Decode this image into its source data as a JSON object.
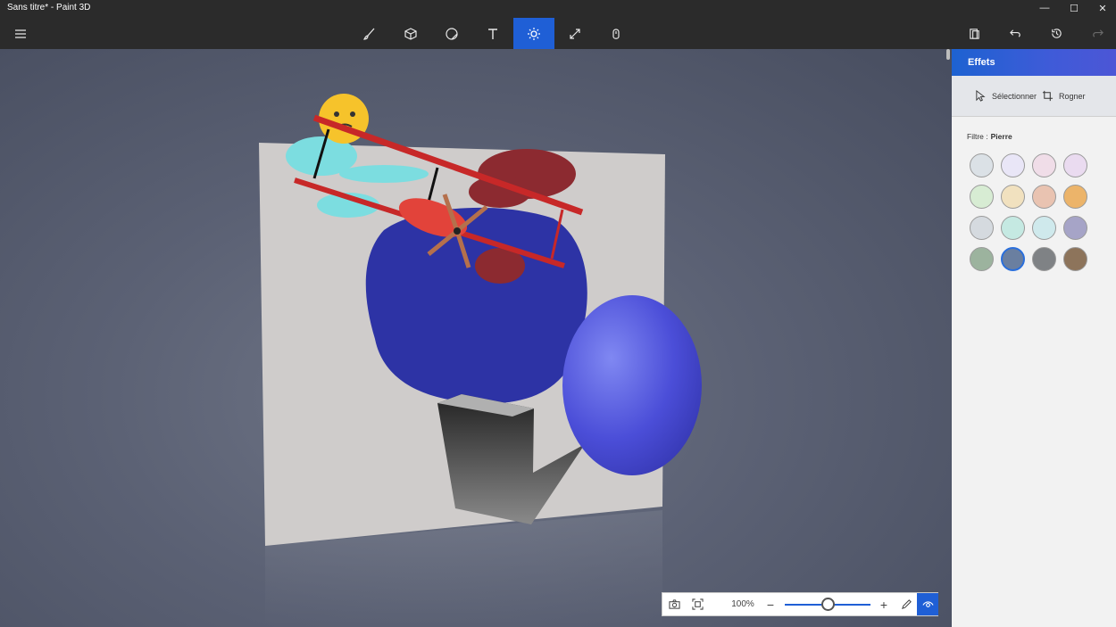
{
  "window": {
    "title": "Sans titre* - Paint 3D"
  },
  "toolbar": {
    "tools": [
      {
        "name": "brushes-icon"
      },
      {
        "name": "3d-shapes-icon"
      },
      {
        "name": "stickers-icon"
      },
      {
        "name": "text-icon"
      },
      {
        "name": "effects-icon",
        "active": true
      },
      {
        "name": "canvas-icon"
      },
      {
        "name": "remix3d-icon"
      }
    ],
    "accent_color": "#1f5fd6"
  },
  "panel": {
    "title": "Effets",
    "select_label": "Sélectionner",
    "crop_label": "Rogner",
    "filter_label": "Filtre :",
    "filter_value": "Pierre",
    "swatches": [
      "#dbe1e6",
      "#e9e6f7",
      "#f0dde8",
      "#eadbf0",
      "#d7ecd3",
      "#f1e1bf",
      "#e9c3b1",
      "#ecb46a",
      "#d5dadf",
      "#c5e9e2",
      "#cfe9ec",
      "#a6a4c7",
      "#9cb39e",
      "#6a7fa0",
      "#7f8285",
      "#8d745b"
    ],
    "selected_swatch": 13
  },
  "zoom": {
    "value": "100%",
    "level_fraction": 0.5
  }
}
